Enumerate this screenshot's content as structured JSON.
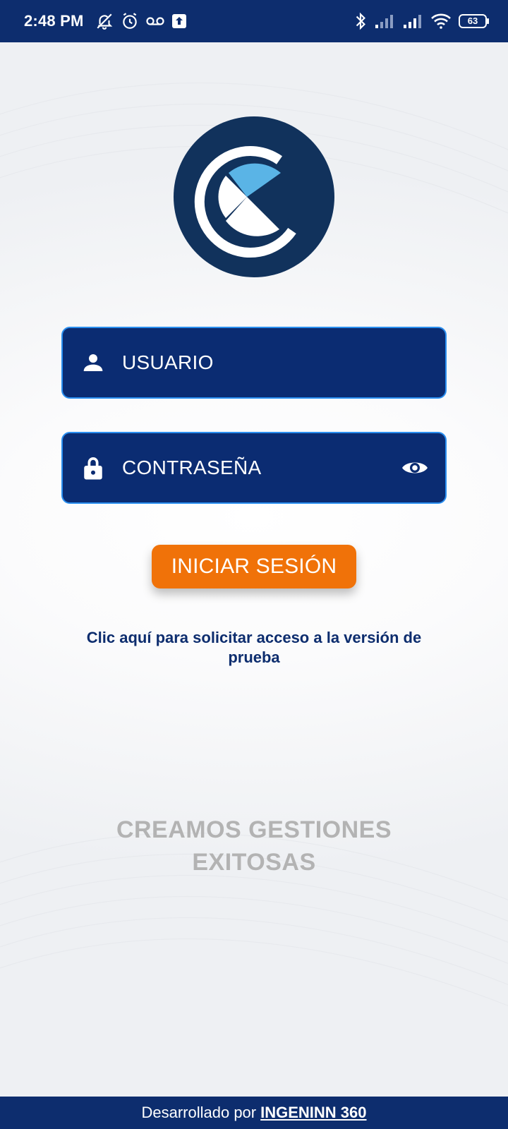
{
  "status_bar": {
    "time": "2:48 PM",
    "battery": "63",
    "icons_left": [
      "muted-bell-icon",
      "alarm-icon",
      "voicemail-icon",
      "upload-icon"
    ],
    "icons_right": [
      "bluetooth-icon",
      "signal-icon",
      "signal-icon",
      "wifi-icon",
      "battery-icon"
    ]
  },
  "login": {
    "username_placeholder": "USUARIO",
    "password_placeholder": "CONTRASEÑA",
    "submit_label": "INICIAR SESIÓN",
    "trial_link": "Clic aquí para solicitar acceso a la versión de prueba"
  },
  "slogan": "CREAMOS GESTIONES EXITOSAS",
  "footer": {
    "prefix": "Desarrollado por",
    "company": "INGENINN 360"
  },
  "colors": {
    "primary": "#0d2d6e",
    "accent": "#f07209",
    "field_border": "#2a8ff0",
    "logo_bg": "#11325c",
    "logo_accent": "#5ab4e6"
  }
}
